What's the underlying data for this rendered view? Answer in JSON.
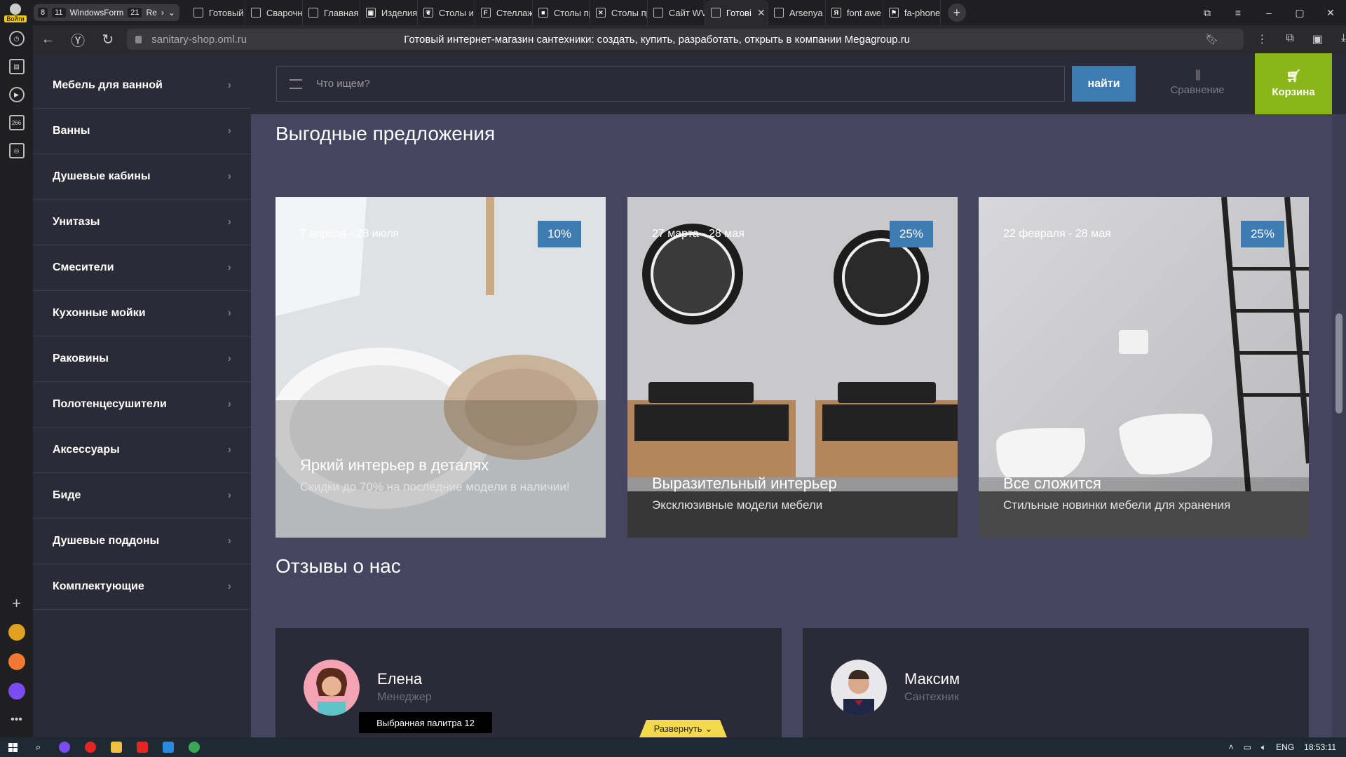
{
  "browser": {
    "login_label": "Войти",
    "tab_group": {
      "count_a": "8",
      "count_b": "11",
      "label_a": "WindowsForm",
      "count_c": "21",
      "label_c": "Re"
    },
    "tabs": [
      {
        "label": "Готовый",
        "icon": "page-icon"
      },
      {
        "label": "Сварочн",
        "icon": "page-icon"
      },
      {
        "label": "Главная",
        "icon": "page-icon"
      },
      {
        "label": "Изделия",
        "icon": "image-icon"
      },
      {
        "label": "Столы и",
        "icon": "leaf-icon"
      },
      {
        "label": "Стеллаж",
        "icon": "f-icon"
      },
      {
        "label": "Столы пр",
        "icon": "black-square-icon"
      },
      {
        "label": "Столы пр",
        "icon": "tools-icon"
      },
      {
        "label": "Сайт WV",
        "icon": "page-icon"
      },
      {
        "label": "Готові",
        "icon": "page-icon",
        "active": true
      },
      {
        "label": "Arsenya",
        "icon": "page-icon"
      },
      {
        "label": "font awe",
        "icon": "yandex-icon"
      },
      {
        "label": "fa-phone",
        "icon": "flag-icon"
      }
    ],
    "url": "sanitary-shop.oml.ru",
    "page_title": "Готовый интернет-магазин сантехники: создать, купить, разработать, открыть в компании Megagroup.ru",
    "sidebar_badge": "266"
  },
  "site": {
    "catalog": [
      "Мебель для ванной",
      "Ванны",
      "Душевые кабины",
      "Унитазы",
      "Смесители",
      "Кухонные мойки",
      "Раковины",
      "Полотенцесушители",
      "Аксессуары",
      "Биде",
      "Душевые поддоны",
      "Комплектующие"
    ],
    "search_placeholder": "Что ищем?",
    "search_button": "найти",
    "compare_label": "Сравнение",
    "cart_label": "Корзина",
    "offers_heading": "Выгодные предложения",
    "offers": [
      {
        "date": "7 апреля - 28 июля",
        "discount": "10%",
        "title": "Яркий интерьер в деталях",
        "subtitle": "Скидки до 70% на последние модели в наличии!"
      },
      {
        "date": "27 марта - 28 мая",
        "discount": "25%",
        "title": "Выразительный интерьер",
        "subtitle": "Эксклюзивные модели мебели"
      },
      {
        "date": "22 февраля - 28 мая",
        "discount": "25%",
        "title": "Все сложится",
        "subtitle": "Стильные новинки мебели для хранения"
      }
    ],
    "reviews_heading": "Отзывы о нас",
    "reviews": [
      {
        "name": "Елена",
        "role": "Менеджер"
      },
      {
        "name": "Максим",
        "role": "Сантехник"
      }
    ],
    "tooltip": "Выбранная палитра 12",
    "expand_label": "Развернуть"
  },
  "taskbar": {
    "lang": "ENG",
    "time": "18:53:11"
  },
  "colors": {
    "page_bg": "#464560",
    "panel_bg": "#2b2b37",
    "accent_blue": "#3f7bb3",
    "cart_green": "#8ab619",
    "expand_yellow": "#f3d94b"
  }
}
